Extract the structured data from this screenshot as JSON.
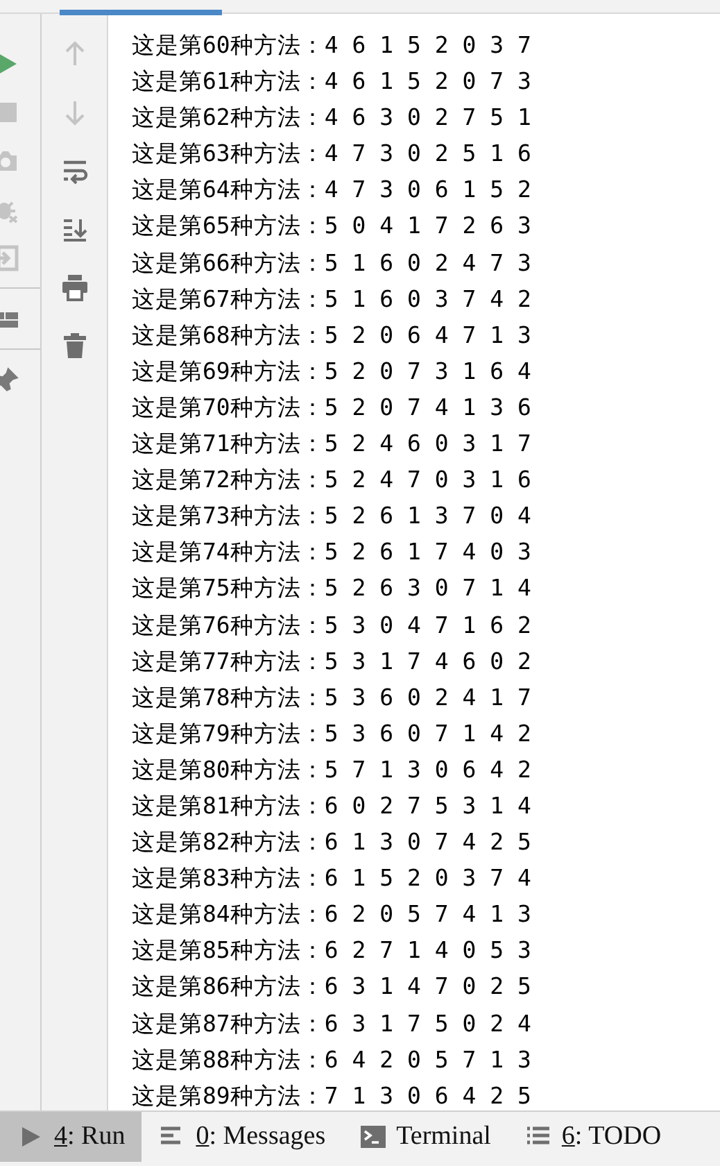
{
  "console": {
    "lines": [
      "这是第60种方法：4 6 1 5 2 0 3 7",
      "这是第61种方法：4 6 1 5 2 0 7 3",
      "这是第62种方法：4 6 3 0 2 7 5 1",
      "这是第63种方法：4 7 3 0 2 5 1 6",
      "这是第64种方法：4 7 3 0 6 1 5 2",
      "这是第65种方法：5 0 4 1 7 2 6 3",
      "这是第66种方法：5 1 6 0 2 4 7 3",
      "这是第67种方法：5 1 6 0 3 7 4 2",
      "这是第68种方法：5 2 0 6 4 7 1 3",
      "这是第69种方法：5 2 0 7 3 1 6 4",
      "这是第70种方法：5 2 0 7 4 1 3 6",
      "这是第71种方法：5 2 4 6 0 3 1 7",
      "这是第72种方法：5 2 4 7 0 3 1 6",
      "这是第73种方法：5 2 6 1 3 7 0 4",
      "这是第74种方法：5 2 6 1 7 4 0 3",
      "这是第75种方法：5 2 6 3 0 7 1 4",
      "这是第76种方法：5 3 0 4 7 1 6 2",
      "这是第77种方法：5 3 1 7 4 6 0 2",
      "这是第78种方法：5 3 6 0 2 4 1 7",
      "这是第79种方法：5 3 6 0 7 1 4 2",
      "这是第80种方法：5 7 1 3 0 6 4 2",
      "这是第81种方法：6 0 2 7 5 3 1 4",
      "这是第82种方法：6 1 3 0 7 4 2 5",
      "这是第83种方法：6 1 5 2 0 3 7 4",
      "这是第84种方法：6 2 0 5 7 4 1 3",
      "这是第85种方法：6 2 7 1 4 0 5 3",
      "这是第86种方法：6 3 1 4 7 0 2 5",
      "这是第87种方法：6 3 1 7 5 0 2 4",
      "这是第88种方法：6 4 2 0 5 7 1 3",
      "这是第89种方法：7 1 3 0 6 4 2 5"
    ]
  },
  "run_toolbar": [
    {
      "kind": "run"
    },
    {
      "kind": "stop"
    },
    {
      "kind": "camera"
    },
    {
      "kind": "bug"
    },
    {
      "kind": "exit"
    },
    {
      "kind": "layout"
    },
    {
      "kind": "pin"
    }
  ],
  "console_toolbar": [
    {
      "kind": "up"
    },
    {
      "kind": "down"
    },
    {
      "kind": "wrap"
    },
    {
      "kind": "scroll"
    },
    {
      "kind": "print"
    },
    {
      "kind": "trash"
    }
  ],
  "tool_windows": [
    {
      "kind": "run",
      "mnemonic": "4",
      "label": ": Run",
      "selected": true
    },
    {
      "kind": "messages",
      "mnemonic": "0",
      "label": ": Messages",
      "selected": false
    },
    {
      "kind": "terminal",
      "label": "Terminal",
      "selected": false
    },
    {
      "kind": "todo",
      "mnemonic": "6",
      "label": ": TODO",
      "selected": false
    }
  ]
}
